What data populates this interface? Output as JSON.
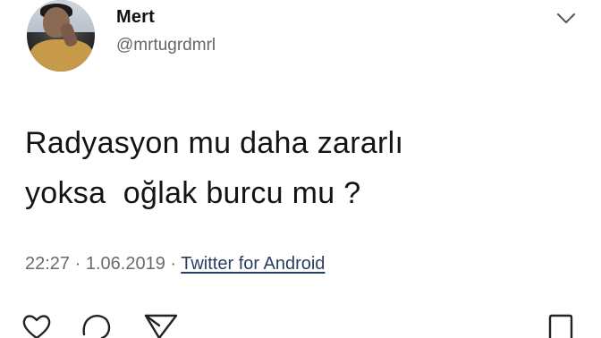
{
  "tweet": {
    "author": {
      "name": "Mert",
      "handle": "@mrtugrdmrl"
    },
    "text": "Radyasyon mu daha zararlı\nyoksa  oğlak burcu mu ?",
    "time": "22:27",
    "separator": " · ",
    "date": "1.06.2019",
    "source": "Twitter for Android"
  },
  "icons": {
    "menu": "chevron-down-icon",
    "like": "heart-icon",
    "comment": "comment-icon",
    "share": "send-icon",
    "save": "bookmark-icon"
  }
}
